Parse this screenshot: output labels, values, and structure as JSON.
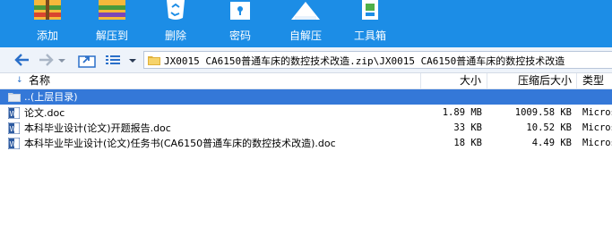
{
  "toolbar": {
    "add": "添加",
    "extract": "解压到",
    "delete": "删除",
    "password": "密码",
    "sfx": "自解压",
    "tools": "工具箱"
  },
  "address": {
    "path": "JX0015 CA6150普通车床的数控技术改造.zip\\JX0015 CA6150普通车床的数控技术改造"
  },
  "columns": {
    "name": "名称",
    "size": "大小",
    "compressed": "压缩后大小",
    "type": "类型"
  },
  "files": [
    {
      "name": "..(上层目录)",
      "size": "",
      "compressed": "",
      "type": ""
    },
    {
      "name": "论文.doc",
      "size": "1.89 MB",
      "compressed": "1009.58 KB",
      "type": "Micros"
    },
    {
      "name": "本科毕业设计(论文)开题报告.doc",
      "size": "33 KB",
      "compressed": "10.52 KB",
      "type": "Micros"
    },
    {
      "name": "本科毕业毕业设计(论文)任务书(CA6150普通车床的数控技术改造).doc",
      "size": "18 KB",
      "compressed": "4.49 KB",
      "type": "Micros"
    }
  ],
  "colors": {
    "toolbar": "#1c8de6",
    "selected_row": "#3478d8"
  },
  "icons": [
    "add-archive-icon",
    "extract-icon",
    "delete-icon",
    "password-lock-icon",
    "sfx-icon",
    "toolbox-icon",
    "back-arrow-icon",
    "forward-arrow-icon",
    "up-folder-icon",
    "view-list-icon",
    "folder-icon",
    "word-doc-icon"
  ]
}
